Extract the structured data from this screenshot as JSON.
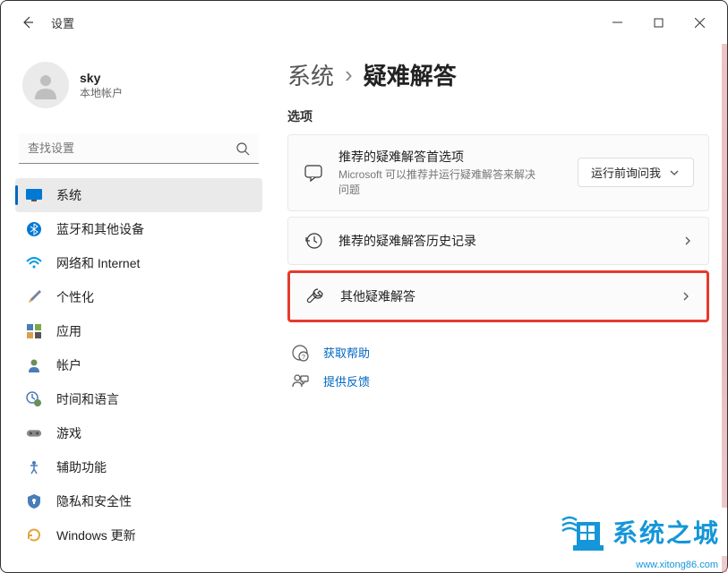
{
  "app_title": "设置",
  "user": {
    "name": "sky",
    "type": "本地帐户"
  },
  "search": {
    "placeholder": "查找设置"
  },
  "nav": {
    "items": [
      {
        "label": "系统",
        "icon": "system"
      },
      {
        "label": "蓝牙和其他设备",
        "icon": "bluetooth"
      },
      {
        "label": "网络和 Internet",
        "icon": "wifi"
      },
      {
        "label": "个性化",
        "icon": "personalize"
      },
      {
        "label": "应用",
        "icon": "apps"
      },
      {
        "label": "帐户",
        "icon": "accounts"
      },
      {
        "label": "时间和语言",
        "icon": "time"
      },
      {
        "label": "游戏",
        "icon": "gaming"
      },
      {
        "label": "辅助功能",
        "icon": "accessibility"
      },
      {
        "label": "隐私和安全性",
        "icon": "privacy"
      },
      {
        "label": "Windows 更新",
        "icon": "update"
      }
    ]
  },
  "breadcrumb": {
    "parent": "系统",
    "sep": "›",
    "current": "疑难解答"
  },
  "section_label": "选项",
  "cards": {
    "recommended": {
      "title": "推荐的疑难解答首选项",
      "subtitle": "Microsoft 可以推荐并运行疑难解答来解决问题",
      "action_label": "运行前询问我"
    },
    "history": {
      "title": "推荐的疑难解答历史记录"
    },
    "other": {
      "title": "其他疑难解答"
    }
  },
  "help": {
    "get_help": "获取帮助",
    "feedback": "提供反馈"
  },
  "watermark": {
    "text": "系统之城",
    "url": "www.xitong86.com"
  }
}
